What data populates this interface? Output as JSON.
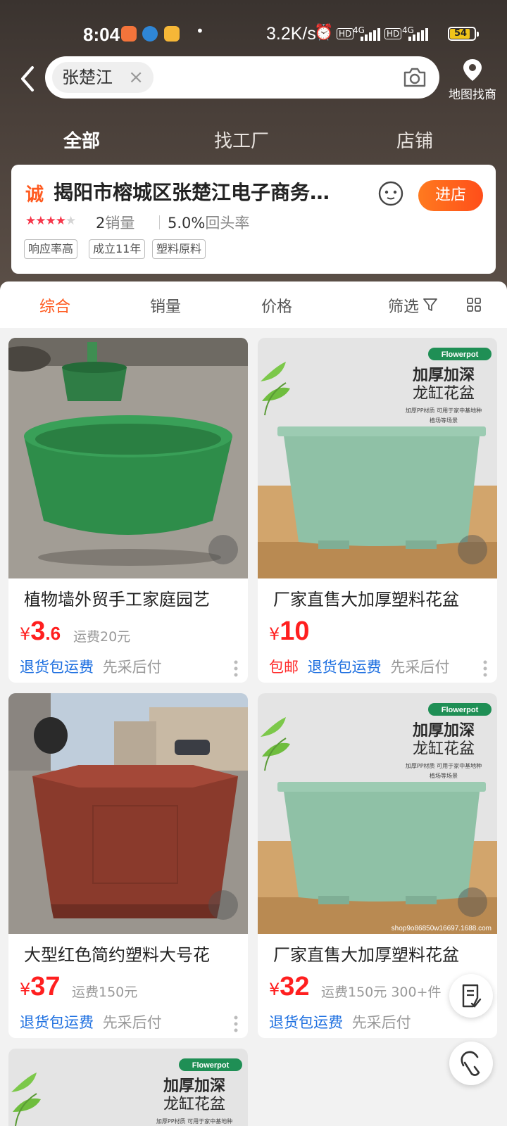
{
  "status_bar": {
    "time": "8:04",
    "dot": "•",
    "speed": "3.2K/s",
    "net1": "HD",
    "gen1": "4G",
    "net2": "HD",
    "gen2": "4G",
    "battery": "54"
  },
  "search": {
    "query": "张楚江",
    "clear": "×"
  },
  "map": {
    "label": "地图找商"
  },
  "top_tabs": [
    "全部",
    "找工厂",
    "店铺"
  ],
  "store": {
    "badge": "诚",
    "name": "揭阳市榕城区张楚江电子商务…",
    "enter_label": "进店",
    "rating_stars": 4,
    "sales_num": "2",
    "sales_label": "销量",
    "repeat_num": "5.0%",
    "repeat_label": "回头率",
    "tags": [
      "响应率高",
      "成立11年",
      "塑料原料"
    ]
  },
  "sort_bar": {
    "items": [
      "综合",
      "销量",
      "价格"
    ],
    "filter_label": "筛选"
  },
  "products": [
    {
      "title": "植物墙外贸手工家庭园艺",
      "yen": "¥",
      "price_int": "3",
      "price_dec": ".6",
      "shipping": "运费20元",
      "extra": "",
      "free_ship": "",
      "return": "退货包运费",
      "pay_later": "先采后付"
    },
    {
      "title": "厂家直售大加厚塑料花盆",
      "yen": "¥",
      "price_int": "10",
      "price_dec": "",
      "shipping": "",
      "extra": "",
      "free_ship": "包邮",
      "return": "退货包运费",
      "pay_later": "先采后付",
      "poster": {
        "badge": "Flowerpot",
        "line1": "加厚加深",
        "line2": "龙缸花盆",
        "small1": "加厚PP材质 可用于家中基地种",
        "small2": "植场等场景"
      }
    },
    {
      "title": "大型红色简约塑料大号花",
      "yen": "¥",
      "price_int": "37",
      "price_dec": "",
      "shipping": "运费150元",
      "extra": "",
      "free_ship": "",
      "return": "退货包运费",
      "pay_later": "先采后付"
    },
    {
      "title": "厂家直售大加厚塑料花盆",
      "yen": "¥",
      "price_int": "32",
      "price_dec": "",
      "shipping": "运费150元",
      "extra": "300+件",
      "free_ship": "",
      "return": "退货包运费",
      "pay_later": "先采后付",
      "poster": {
        "badge": "Flowerpot",
        "line1": "加厚加深",
        "line2": "龙缸花盆",
        "small1": "加厚PP材质 可用于家中基地种",
        "small2": "植场等场景",
        "watermark": "shop9o86850w16697.1688.com"
      }
    },
    {
      "poster": {
        "badge": "Flowerpot",
        "line1": "加厚加深",
        "line2": "龙缸花盆",
        "small1": "加厚PP材质 可用于家中基地种"
      }
    }
  ],
  "colors": {
    "accent": "#ff5a1f",
    "price_red": "#ff1f1f",
    "link_blue": "#1d6fe0"
  }
}
